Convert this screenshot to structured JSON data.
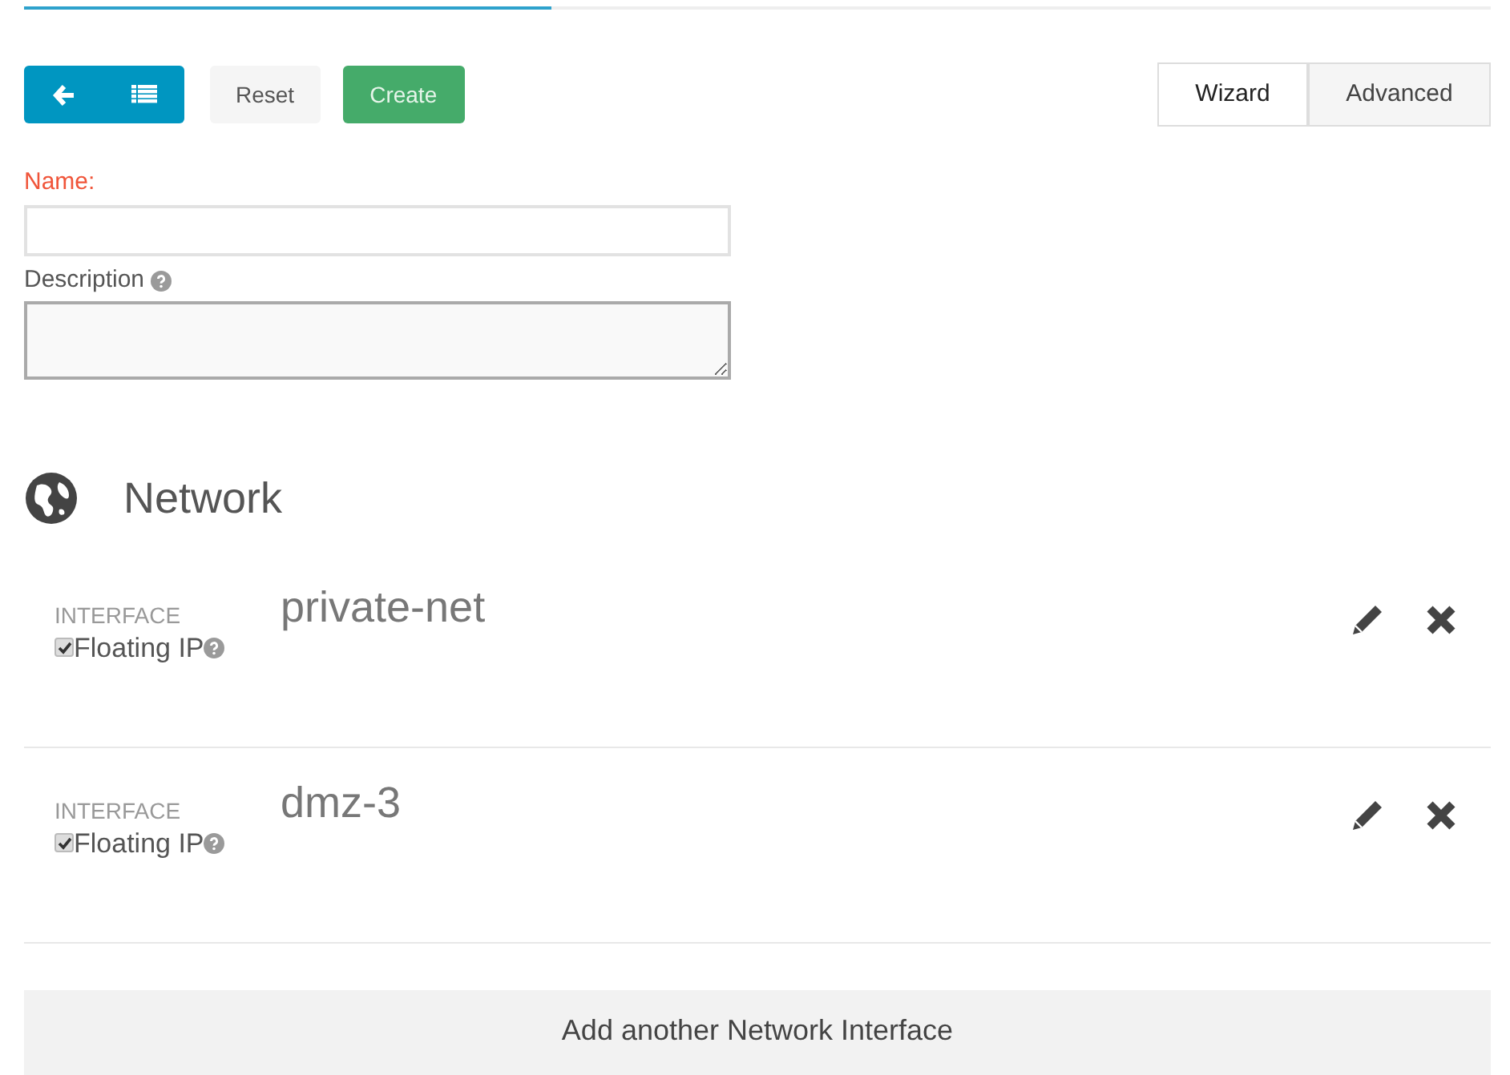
{
  "progress": {
    "level": 0.36
  },
  "toolbar": {
    "buttons": [
      {
        "kind": "back"
      },
      {
        "kind": "list"
      }
    ],
    "reset": "Reset",
    "create": "Create"
  },
  "mode_tabs": [
    {
      "label": "Wizard",
      "selected": true
    },
    {
      "label": "Advanced",
      "selected": false
    }
  ],
  "form": {
    "name_label": "Name:",
    "name_required": true,
    "description_label": "Description"
  },
  "network": {
    "title": "Network",
    "interfaces": [
      {
        "label": "INTERFACE",
        "name": "private-net",
        "floating_ip": {
          "label": "Floating IP",
          "checked": true
        }
      },
      {
        "label": "INTERFACE",
        "name": "dmz-3",
        "floating_ip": {
          "label": "Floating IP",
          "checked": true
        }
      }
    ],
    "add_button": "Add another Network Interface"
  }
}
